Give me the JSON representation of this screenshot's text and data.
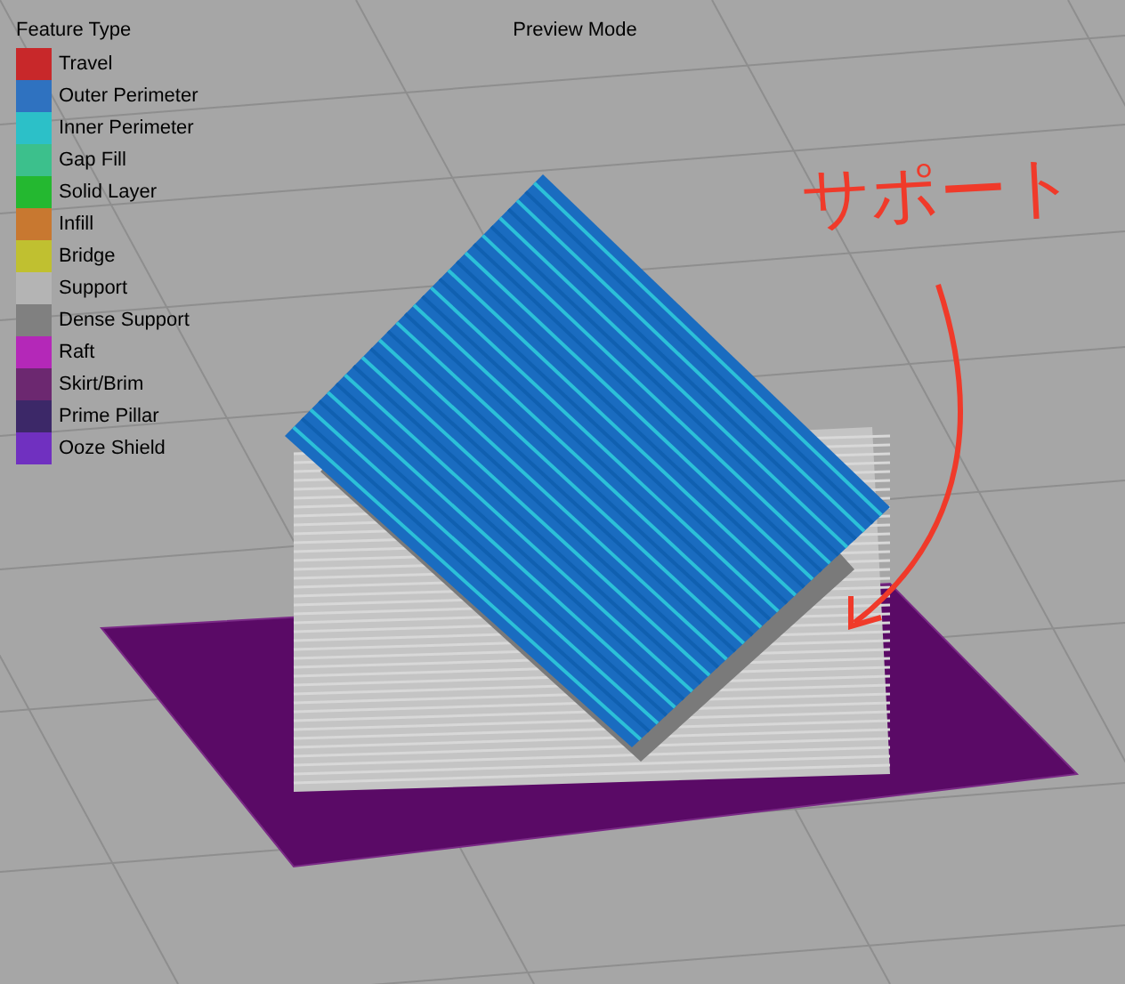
{
  "legend": {
    "title": "Feature Type",
    "items": [
      {
        "label": "Travel",
        "color": "#c8282a"
      },
      {
        "label": "Outer Perimeter",
        "color": "#2f72c0"
      },
      {
        "label": "Inner Perimeter",
        "color": "#2cc0c8"
      },
      {
        "label": "Gap Fill",
        "color": "#3cc08c"
      },
      {
        "label": "Solid Layer",
        "color": "#24b830"
      },
      {
        "label": "Infill",
        "color": "#c87830"
      },
      {
        "label": "Bridge",
        "color": "#c0c030"
      },
      {
        "label": "Support",
        "color": "#b4b4b4"
      },
      {
        "label": "Dense Support",
        "color": "#808080"
      },
      {
        "label": "Raft",
        "color": "#b428b8"
      },
      {
        "label": "Skirt/Brim",
        "color": "#6c2870"
      },
      {
        "label": "Prime Pillar",
        "color": "#3c2868"
      },
      {
        "label": "Ooze Shield",
        "color": "#7030c0"
      }
    ]
  },
  "view": {
    "title": "Preview Mode"
  },
  "annotation": {
    "text": "サポート"
  }
}
